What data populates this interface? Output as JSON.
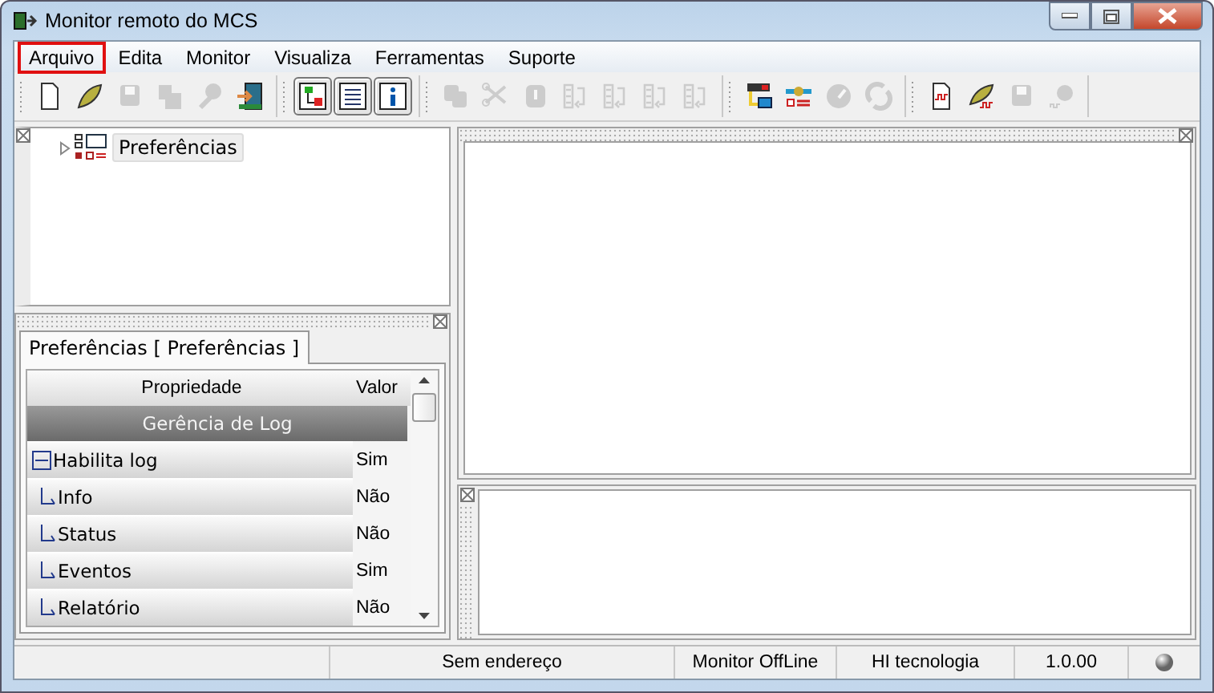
{
  "window": {
    "title": "Monitor remoto do MCS"
  },
  "menu": [
    {
      "label": "Arquivo",
      "highlighted": true
    },
    {
      "label": "Edita",
      "highlighted": false
    },
    {
      "label": "Monitor",
      "highlighted": false
    },
    {
      "label": "Visualiza",
      "highlighted": false
    },
    {
      "label": "Ferramentas",
      "highlighted": false
    },
    {
      "label": "Suporte",
      "highlighted": false
    }
  ],
  "toolbar": [
    [
      {
        "kind": "new",
        "disabled": false,
        "pressed": false
      },
      {
        "kind": "open",
        "disabled": false,
        "pressed": false
      },
      {
        "kind": "save",
        "disabled": true,
        "pressed": false
      },
      {
        "kind": "saveas",
        "disabled": true,
        "pressed": false
      },
      {
        "kind": "connect",
        "disabled": true,
        "pressed": false
      },
      {
        "kind": "exit",
        "disabled": false,
        "pressed": false
      }
    ],
    [
      {
        "kind": "tree",
        "disabled": false,
        "pressed": true
      },
      {
        "kind": "list",
        "disabled": false,
        "pressed": true
      },
      {
        "kind": "info",
        "disabled": false,
        "pressed": true
      }
    ],
    [
      {
        "kind": "copy",
        "disabled": true,
        "pressed": false
      },
      {
        "kind": "cut",
        "disabled": true,
        "pressed": false
      },
      {
        "kind": "paste",
        "disabled": true,
        "pressed": false
      },
      {
        "kind": "align",
        "disabled": true,
        "pressed": false
      },
      {
        "kind": "align",
        "disabled": true,
        "pressed": false
      },
      {
        "kind": "align",
        "disabled": true,
        "pressed": false
      },
      {
        "kind": "align",
        "disabled": true,
        "pressed": false
      }
    ],
    [
      {
        "kind": "network",
        "disabled": false,
        "pressed": false
      },
      {
        "kind": "config",
        "disabled": false,
        "pressed": false
      },
      {
        "kind": "gauge",
        "disabled": true,
        "pressed": false
      },
      {
        "kind": "refresh",
        "disabled": true,
        "pressed": false
      }
    ],
    [
      {
        "kind": "wavedoc",
        "disabled": false,
        "pressed": false
      },
      {
        "kind": "waveopen",
        "disabled": false,
        "pressed": false
      },
      {
        "kind": "save",
        "disabled": true,
        "pressed": false
      },
      {
        "kind": "record",
        "disabled": true,
        "pressed": false
      }
    ]
  ],
  "tree": {
    "items": [
      {
        "label": "Preferências",
        "expanded": false
      }
    ]
  },
  "properties": {
    "tab": "Preferências [ Preferências ]",
    "columns": [
      "Propriedade",
      "Valor"
    ],
    "category": "Gerência de Log",
    "rows": [
      {
        "name": "Habilita log",
        "value": "Sim",
        "expanded": true,
        "children": [
          {
            "name": "Info",
            "value": "Não"
          },
          {
            "name": "Status",
            "value": "Não"
          },
          {
            "name": "Eventos",
            "value": "Sim"
          },
          {
            "name": "Relatório",
            "value": "Não"
          }
        ]
      }
    ]
  },
  "status_bar": [
    "Sem endereço",
    "Monitor OffLine",
    "HI tecnologia",
    "1.0.00"
  ]
}
